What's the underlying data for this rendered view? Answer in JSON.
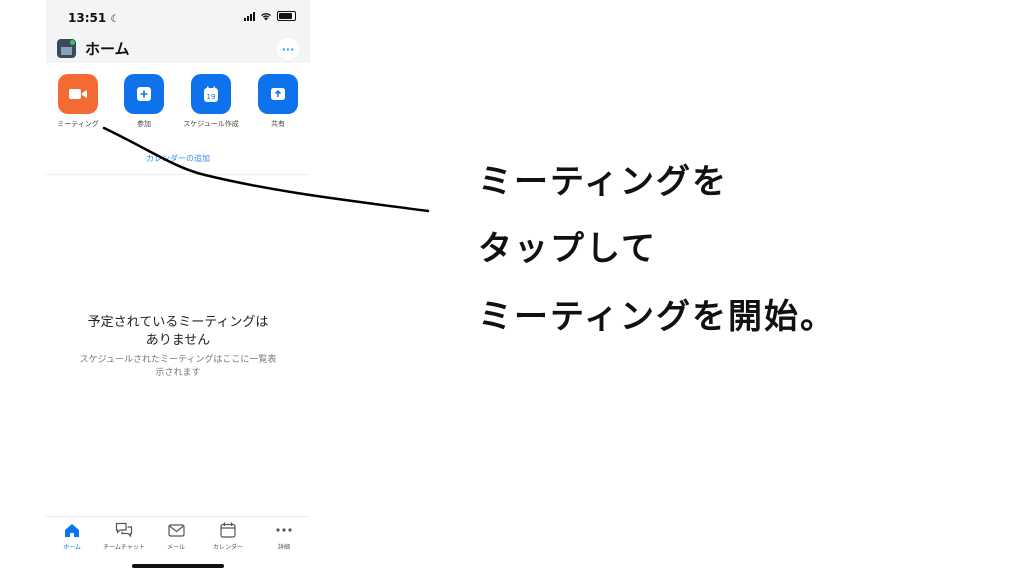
{
  "status_bar": {
    "time": "13:51",
    "moon": "☾"
  },
  "header": {
    "title": "ホーム",
    "more": "···"
  },
  "actions": [
    {
      "label": "ミーティング",
      "icon": "video-camera-icon",
      "color": "#f46a35"
    },
    {
      "label": "参加",
      "icon": "plus-icon",
      "color": "#0e72ed"
    },
    {
      "label": "スケジュール作成",
      "icon": "calendar-icon",
      "color": "#0e72ed",
      "date": "19"
    },
    {
      "label": "共有",
      "icon": "share-upload-icon",
      "color": "#0e72ed"
    }
  ],
  "calendar_link": "カレンダーの追加",
  "empty_state": {
    "title_line1": "予定されているミーティングは",
    "title_line2": "ありません",
    "subtitle_line1": "スケジュールされたミーティングはここに一覧表",
    "subtitle_line2": "示されます"
  },
  "tabs": [
    {
      "label": "ホーム",
      "icon": "home-icon",
      "active": true
    },
    {
      "label": "チームチャット",
      "icon": "chat-icon",
      "active": false
    },
    {
      "label": "メール",
      "icon": "mail-icon",
      "active": false
    },
    {
      "label": "カレンダー",
      "icon": "calendar-icon",
      "active": false
    },
    {
      "label": "詳細",
      "icon": "more-icon",
      "active": false
    }
  ],
  "annotation": {
    "line1": "ミーティングを",
    "line2": "タップして",
    "line3": "ミーティングを開始。"
  },
  "colors": {
    "accent": "#0e72ed",
    "meeting": "#f46a35",
    "link": "#2d8cff"
  }
}
